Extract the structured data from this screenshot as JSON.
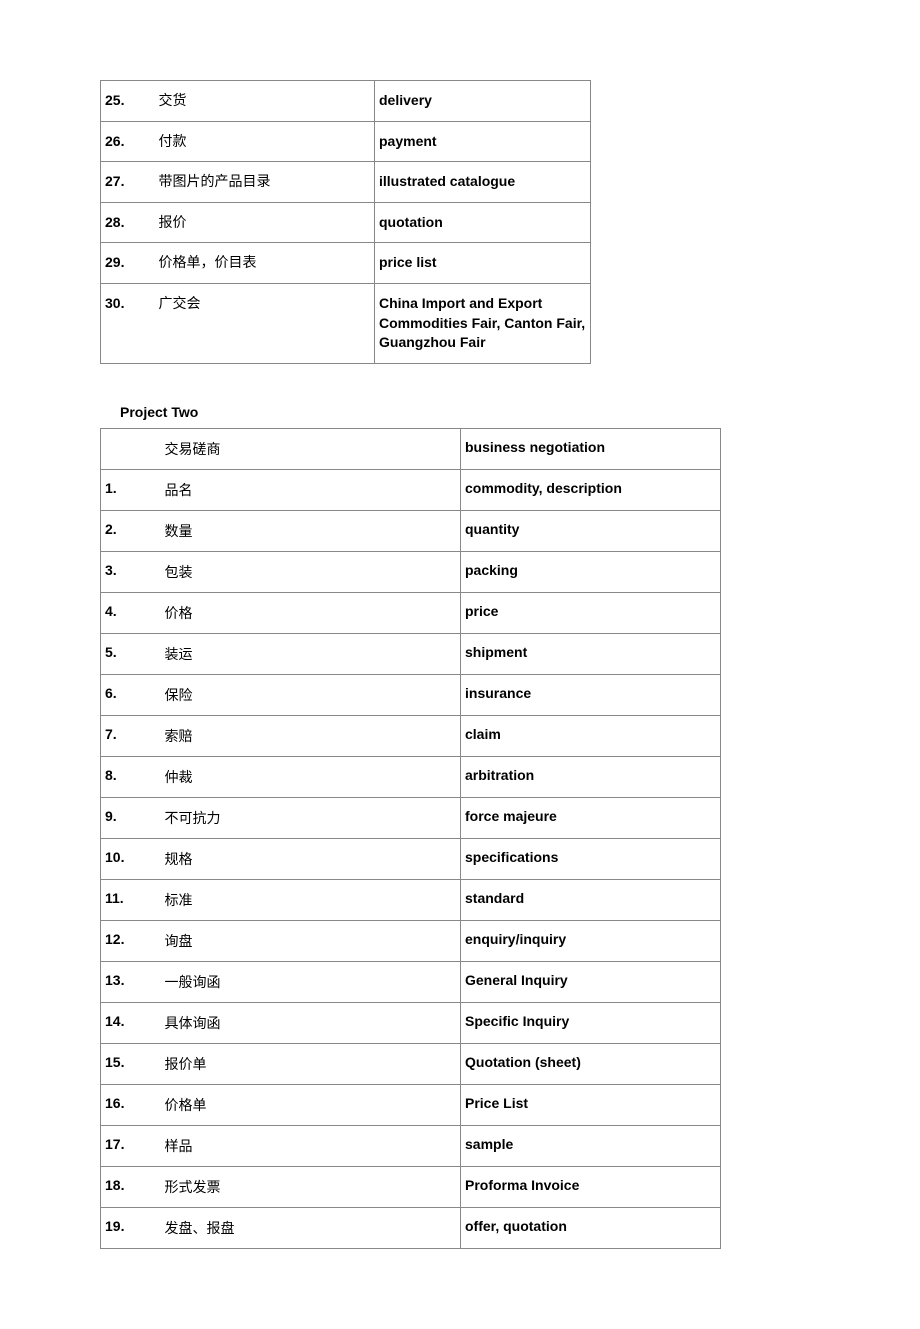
{
  "table1": {
    "rows": [
      {
        "num": "25.",
        "cn": "交货",
        "en": "delivery"
      },
      {
        "num": "26.",
        "cn": "付款",
        "en": "payment"
      },
      {
        "num": "27.",
        "cn": "带图片的产品目录",
        "en": "illustrated catalogue"
      },
      {
        "num": "28.",
        "cn": "报价",
        "en": "quotation"
      },
      {
        "num": "29.",
        "cn": "价格单，价目表",
        "en": "price list"
      },
      {
        "num": "30.",
        "cn": "广交会",
        "en": "China Import and Export Commodities Fair, Canton Fair, Guangzhou Fair"
      }
    ]
  },
  "section2_title": "Project Two",
  "table2": {
    "rows": [
      {
        "num": "",
        "cn": "交易磋商",
        "en": "business negotiation"
      },
      {
        "num": "1.",
        "cn": "品名",
        "en": "commodity, description"
      },
      {
        "num": "2.",
        "cn": "数量",
        "en": "quantity"
      },
      {
        "num": "3.",
        "cn": "包装",
        "en": "packing"
      },
      {
        "num": "4.",
        "cn": "价格",
        "en": "price"
      },
      {
        "num": "5.",
        "cn": "装运",
        "en": "shipment"
      },
      {
        "num": "6.",
        "cn": "保险",
        "en": "insurance"
      },
      {
        "num": "7.",
        "cn": "索赔",
        "en": "claim"
      },
      {
        "num": "8.",
        "cn": "仲裁",
        "en": "arbitration"
      },
      {
        "num": "9.",
        "cn": "不可抗力",
        "en": "force majeure"
      },
      {
        "num": "10.",
        "cn": "规格",
        "en": "specifications"
      },
      {
        "num": "11.",
        "cn": "标准",
        "en": "standard"
      },
      {
        "num": "12.",
        "cn": "询盘",
        "en": "enquiry/inquiry"
      },
      {
        "num": "13.",
        "cn": "一般询函",
        "en": "General Inquiry"
      },
      {
        "num": "14.",
        "cn": "具体询函",
        "en": "Specific Inquiry"
      },
      {
        "num": "15.",
        "cn": "报价单",
        "en": "Quotation (sheet)"
      },
      {
        "num": "16.",
        "cn": "价格单",
        "en": "Price List"
      },
      {
        "num": "17.",
        "cn": "样品",
        "en": "sample"
      },
      {
        "num": "18.",
        "cn": "形式发票",
        "en": "Proforma Invoice"
      },
      {
        "num": "19.",
        "cn": "发盘、报盘",
        "en": "offer, quotation"
      }
    ]
  }
}
